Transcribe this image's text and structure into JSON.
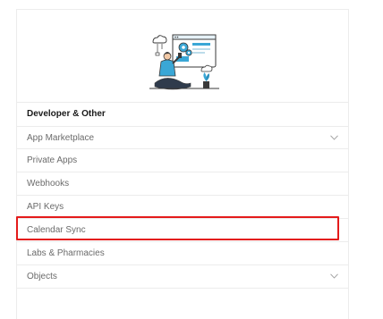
{
  "illustration": {
    "name": "developer-illustration",
    "accent": "#3aa7d6"
  },
  "section": {
    "title": "Developer & Other"
  },
  "menu": [
    {
      "label": "App Marketplace",
      "has_chevron": true
    },
    {
      "label": "Private Apps",
      "has_chevron": false
    },
    {
      "label": "Webhooks",
      "has_chevron": false
    },
    {
      "label": "API Keys",
      "has_chevron": false
    },
    {
      "label": "Calendar Sync",
      "has_chevron": false,
      "highlighted": true
    },
    {
      "label": "Labs & Pharmacies",
      "has_chevron": false
    },
    {
      "label": "Objects",
      "has_chevron": true
    }
  ],
  "colors": {
    "highlight_border": "#e41b1b",
    "divider": "#ececec",
    "item_text": "#6b6b6b",
    "title_text": "#1a1a1a"
  }
}
